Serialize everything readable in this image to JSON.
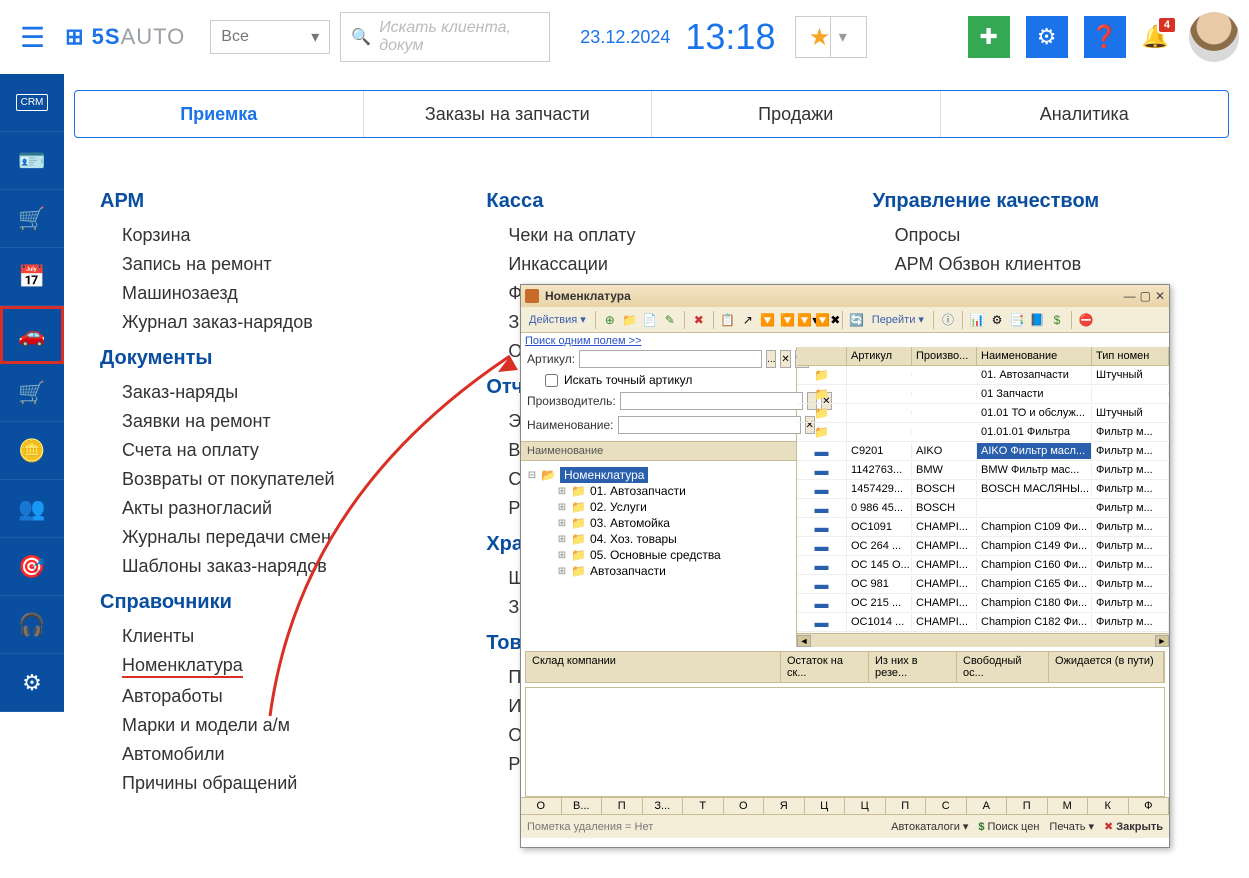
{
  "header": {
    "logo_a": "5S",
    "logo_b": "AUTO",
    "all_dropdown": "Все",
    "search_placeholder": "Искать клиента, докум",
    "date": "23.12.2024",
    "time": "13:18",
    "badge": "4"
  },
  "tabs": [
    "Приемка",
    "Заказы на запчасти",
    "Продажи",
    "Аналитика"
  ],
  "menus": {
    "arm": {
      "title": "АРМ",
      "items": [
        "Корзина",
        "Запись на ремонт",
        "Машинозаезд",
        "Журнал заказ-нарядов"
      ]
    },
    "docs": {
      "title": "Документы",
      "items": [
        "Заказ-наряды",
        "Заявки на ремонт",
        "Счета на оплату",
        "Возвраты от покупателей",
        "Акты разногласий",
        "Журналы передачи смен",
        "Шаблоны заказ-нарядов"
      ]
    },
    "ref": {
      "title": "Справочники",
      "items": [
        "Клиенты",
        "Номенклатура",
        "Авторабoты",
        "Марки и модели а/м",
        "Автомобили",
        "Причины обращений"
      ]
    },
    "kassa": {
      "title": "Касса",
      "items": [
        "Чеки на оплату",
        "Инкассации",
        "Фронт н",
        "Закрыт",
        "Остатк"
      ]
    },
    "reports": {
      "title": "Отчеты",
      "items": [
        "Эффек",
        "Вырабо",
        "Сводна",
        "Реестр"
      ]
    },
    "storage": {
      "title": "Хранени",
      "items": [
        "Шинны",
        "Заявки"
      ]
    },
    "goods": {
      "title": "Товары в",
      "items": [
        "Перемец",
        "Извлеч",
        "Остатки",
        "Расход"
      ]
    },
    "qual": {
      "title": "Управление качеством",
      "items": [
        "Опросы",
        "АРМ Обзвон клиентов"
      ]
    }
  },
  "dialog": {
    "title": "Номенклатура",
    "actions_label": "Действия",
    "goto_label": "Перейти",
    "search_link": "Поиск одним полем >>",
    "fields": {
      "article": "Артикул:",
      "exact": "Искать точный артикул",
      "manufacturer": "Производитель:",
      "name": "Наименование:"
    },
    "tree_header": "Наименование",
    "tree_root": "Номенклатура",
    "tree_items": [
      "01. Автозапчасти",
      "02. Услуги",
      "03. Автомойка",
      "04. Хоз. товары",
      "05. Основные средства",
      "Автозапчасти"
    ],
    "grid_headers": [
      "",
      "Артикул",
      "Произво...",
      "Наименование",
      "Тип номен"
    ],
    "grid_rows": [
      {
        "t": "f",
        "a": "",
        "m": "",
        "n": "01. Автозапчасти",
        "ty": "Штучный"
      },
      {
        "t": "f",
        "a": "",
        "m": "",
        "n": "01 Запчасти",
        "ty": ""
      },
      {
        "t": "f",
        "a": "",
        "m": "",
        "n": "01.01 ТО и обслуж...",
        "ty": "Штучный"
      },
      {
        "t": "f",
        "a": "",
        "m": "",
        "n": "01.01.01 Фильтра",
        "ty": "Фильтр м..."
      },
      {
        "t": "i",
        "a": "C9201",
        "m": "AIKO",
        "n": "AIKO Фильтр масл...",
        "ty": "Фильтр м...",
        "sel": true
      },
      {
        "t": "i",
        "a": "1142763...",
        "m": "BMW",
        "n": "BMW Фильтр мас...",
        "ty": "Фильтр м..."
      },
      {
        "t": "i",
        "a": "1457429...",
        "m": "BOSCH",
        "n": "BOSCH МАСЛЯНЫ...",
        "ty": "Фильтр м..."
      },
      {
        "t": "i",
        "a": "0 986 45...",
        "m": "BOSCH",
        "n": "",
        "ty": "Фильтр м..."
      },
      {
        "t": "i",
        "a": "OC1091",
        "m": "CHAMPI...",
        "n": "Champion C109 Фи...",
        "ty": "Фильтр м..."
      },
      {
        "t": "i",
        "a": "OC 264 ...",
        "m": "CHAMPI...",
        "n": "Champion C149 Фи...",
        "ty": "Фильтр м..."
      },
      {
        "t": "i",
        "a": "OC 145 O...",
        "m": "CHAMPI...",
        "n": "Champion C160 Фи...",
        "ty": "Фильтр м..."
      },
      {
        "t": "i",
        "a": "OC 981",
        "m": "CHAMPI...",
        "n": "Champion C165 Фи...",
        "ty": "Фильтр м..."
      },
      {
        "t": "i",
        "a": "OC 215 ...",
        "m": "CHAMPI...",
        "n": "Champion C180 Фи...",
        "ty": "Фильтр м..."
      },
      {
        "t": "i",
        "a": "OC1014 ...",
        "m": "CHAMPI...",
        "n": "Champion C182 Фи...",
        "ty": "Фильтр м..."
      }
    ],
    "stock_headers": [
      "Склад компании",
      "Остаток на ск...",
      "Из них в резе...",
      "Свободный ос...",
      "Ожидается (в пути)"
    ],
    "alpha": [
      "О",
      "В...",
      "П",
      "З...",
      "Т",
      "О",
      "Я",
      "Ц",
      "Ц",
      "П",
      "С",
      "А",
      "П",
      "М",
      "К",
      "Ф"
    ],
    "footer_del": "Пометка удаления = Нет",
    "footer_auto": "Автокаталоги",
    "footer_price": "Поиск цен",
    "footer_print": "Печать",
    "footer_close": "Закрыть"
  }
}
